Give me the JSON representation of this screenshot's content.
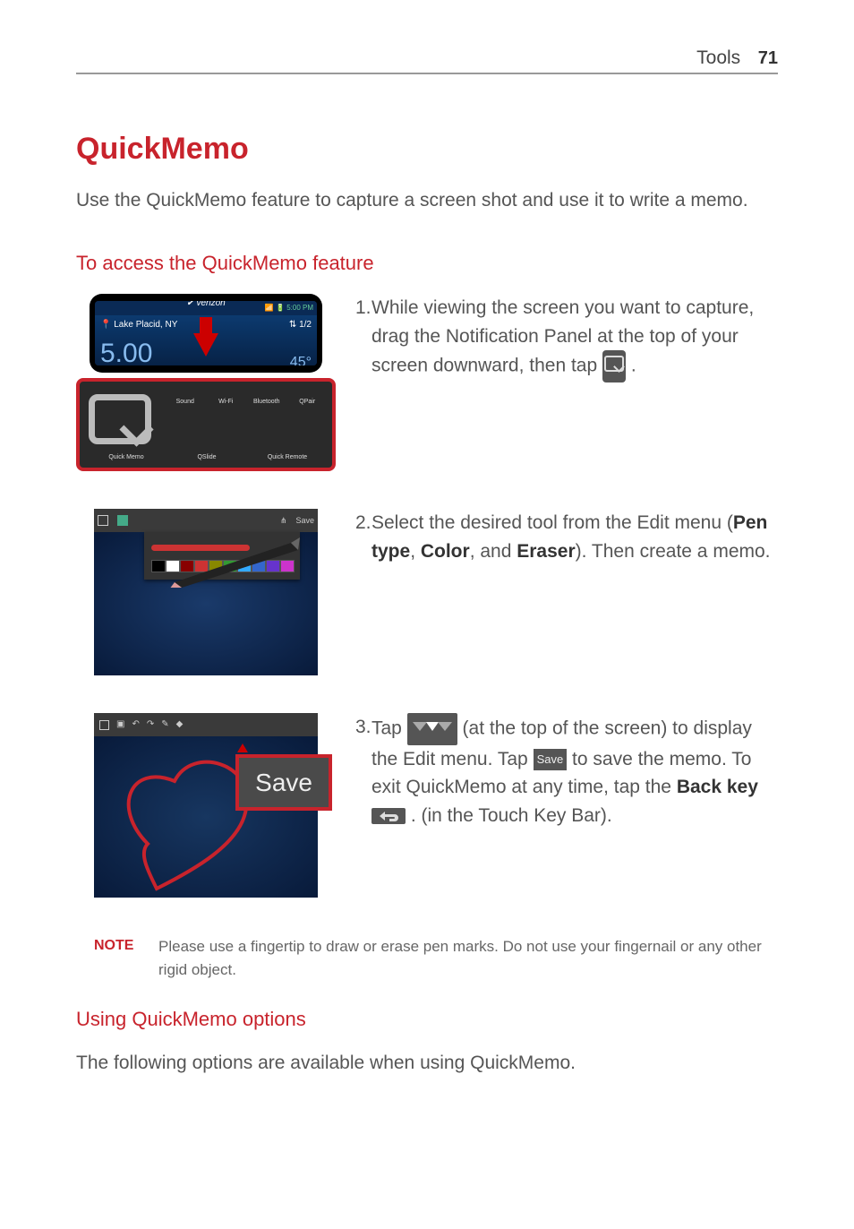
{
  "header": {
    "section": "Tools",
    "page": "71"
  },
  "title": "QuickMemo",
  "intro": "Use the QuickMemo feature to capture a screen shot and use it to write a memo.",
  "h2_access": "To access the QuickMemo feature",
  "steps": {
    "s1": {
      "num": "1.",
      "text_a": "While viewing the screen you want to capture, drag the Notification Panel at the top of your screen downward, then tap ",
      "text_b": "."
    },
    "s2": {
      "num": "2.",
      "text_a": "Select the desired tool from the Edit menu (",
      "b1": "Pen type",
      "sep1": ", ",
      "b2": "Color",
      "sep2": ", and ",
      "b3": "Eraser",
      "text_b": "). Then create a memo."
    },
    "s3": {
      "num": "3.",
      "text_a": "Tap ",
      "text_b": " (at the top of the screen) to display the Edit menu. Tap ",
      "save_chip": "Save",
      "text_c": " to save the memo. To exit QuickMemo at any time, tap the ",
      "b1": "Back key",
      "text_d": " . (in the Touch Key Bar)."
    }
  },
  "fig1": {
    "carrier": "verizon",
    "time": "5:00 PM",
    "location": "Lake Placid, NY",
    "counter": "1/2",
    "clock": "5.00",
    "temp": "45°",
    "toggles": [
      "Quick Memo",
      "QSlide",
      "Quick Remote",
      "Sound",
      "Wi-Fi",
      "Bluetooth",
      "QPair"
    ]
  },
  "fig2": {
    "save_label": "Save"
  },
  "fig3": {
    "save_label": "Save"
  },
  "note": {
    "label": "NOTE",
    "text": "Please use a fingertip to draw or erase pen marks. Do not use your fingernail or any other rigid object."
  },
  "h2_options": "Using QuickMemo options",
  "options_intro": "The following options are available when using QuickMemo."
}
